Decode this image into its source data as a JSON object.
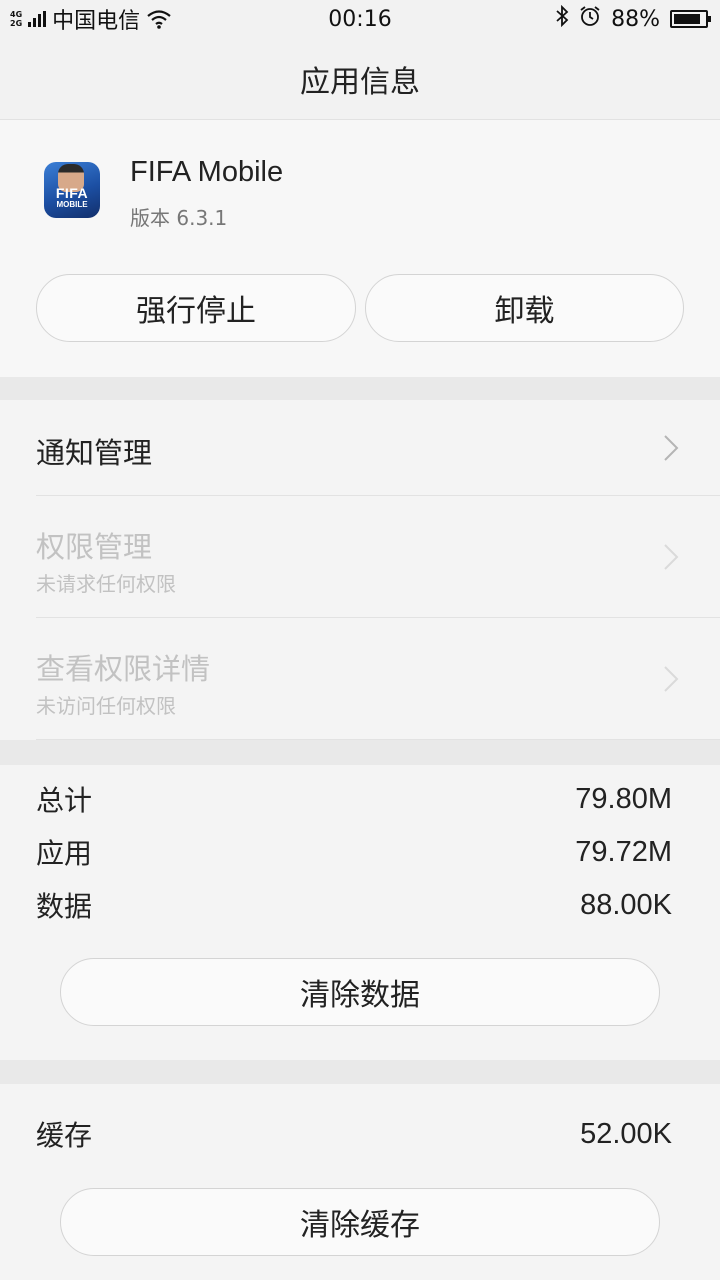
{
  "status_bar": {
    "network_top": "4G",
    "network_bottom": "2G",
    "carrier": "中国电信",
    "time": "00:16",
    "battery_text": "88%",
    "battery_level": 0.88,
    "icons": [
      "signal-icon",
      "wifi-icon",
      "bluetooth-icon",
      "alarm-icon",
      "battery-icon"
    ]
  },
  "header": {
    "title": "应用信息"
  },
  "app": {
    "name": "FIFA Mobile",
    "version": "版本 6.3.1",
    "icon_text": "FIFA",
    "icon_subtext": "MOBILE",
    "stop_label": "强行停止",
    "uninstall_label": "卸载"
  },
  "settings": {
    "notification": {
      "title": "通知管理"
    },
    "permissions": {
      "title": "权限管理",
      "subtitle": "未请求任何权限"
    },
    "permission_details": {
      "title": "查看权限详情",
      "subtitle": "未访问任何权限"
    }
  },
  "storage": {
    "total_label": "总计",
    "total_value": "79.80M",
    "app_label": "应用",
    "app_value": "79.72M",
    "data_label": "数据",
    "data_value": "88.00K",
    "clear_data_label": "清除数据"
  },
  "cache": {
    "label": "缓存",
    "value": "52.00K",
    "clear_cache_label": "清除缓存"
  },
  "colors": {
    "background": "#f4f4f4",
    "section_gap": "#e9e9e9",
    "disabled_text": "#c2c2c2"
  }
}
